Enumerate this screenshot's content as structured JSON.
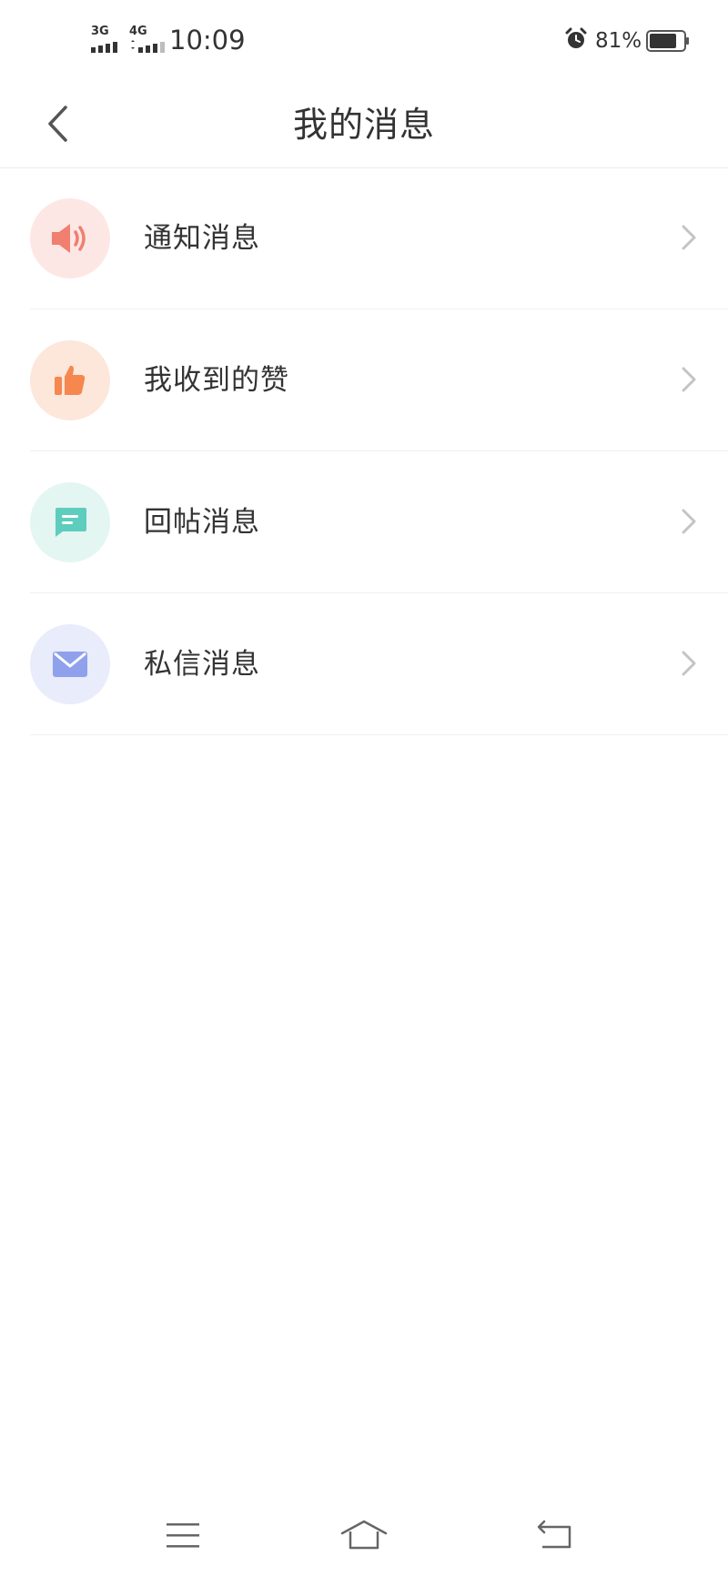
{
  "status_bar": {
    "sim1_label": "3G",
    "sim2_label": "4G",
    "time": "10:09",
    "battery_percent": "81%",
    "battery_level": 0.81,
    "icons": [
      "signal-icon",
      "alarm-icon",
      "battery-icon"
    ]
  },
  "header": {
    "title": "我的消息",
    "back_icon": "chevron-left-icon"
  },
  "messages": {
    "items": [
      {
        "label": "通知消息",
        "icon": "speaker-icon",
        "icon_color": "#f07f70",
        "bg_color": "#fde7e4"
      },
      {
        "label": "我收到的赞",
        "icon": "thumbs-up-icon",
        "icon_color": "#f5874f",
        "bg_color": "#fde6da"
      },
      {
        "label": "回帖消息",
        "icon": "comment-icon",
        "icon_color": "#5fcdbd",
        "bg_color": "#e3f6f2"
      },
      {
        "label": "私信消息",
        "icon": "mail-icon",
        "icon_color": "#8fa1ec",
        "bg_color": "#e8ecfb"
      }
    ]
  },
  "nav_bar": {
    "icons": [
      "menu-icon",
      "home-icon",
      "back-icon"
    ]
  },
  "colors": {
    "text": "#333333",
    "divider": "#f0f0f0",
    "chevron": "#c4c4c4",
    "nav_icon": "#666666"
  }
}
